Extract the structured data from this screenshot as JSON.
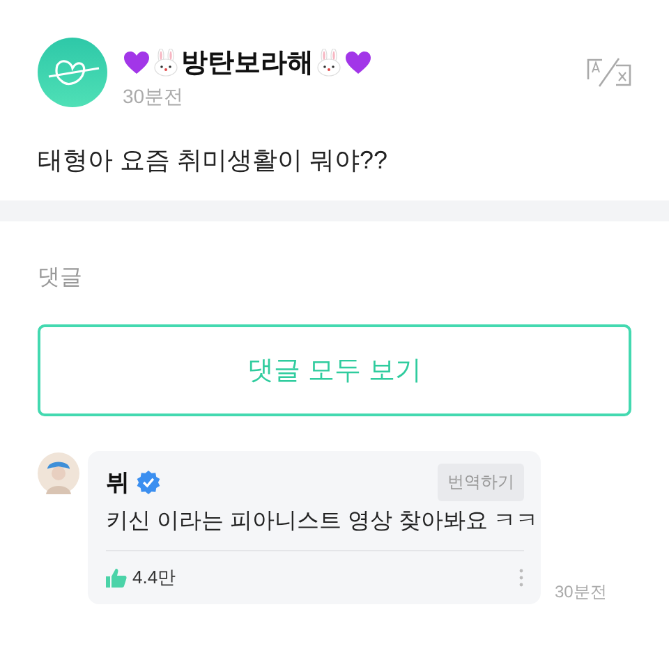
{
  "post": {
    "author": "방탄보라해",
    "time": "30분전",
    "text": "태형아 요즘 취미생활이 뭐야??"
  },
  "comments_section": {
    "heading": "댓글",
    "view_all_button": "댓글 모두 보기",
    "comments": [
      {
        "author": "뷔",
        "verified": true,
        "translate_button": "번역하기",
        "text": "키신 이라는 피아니스트 영상 찾아봐요 ㅋㅋ",
        "likes": "4.4만",
        "time": "30분전"
      }
    ]
  }
}
